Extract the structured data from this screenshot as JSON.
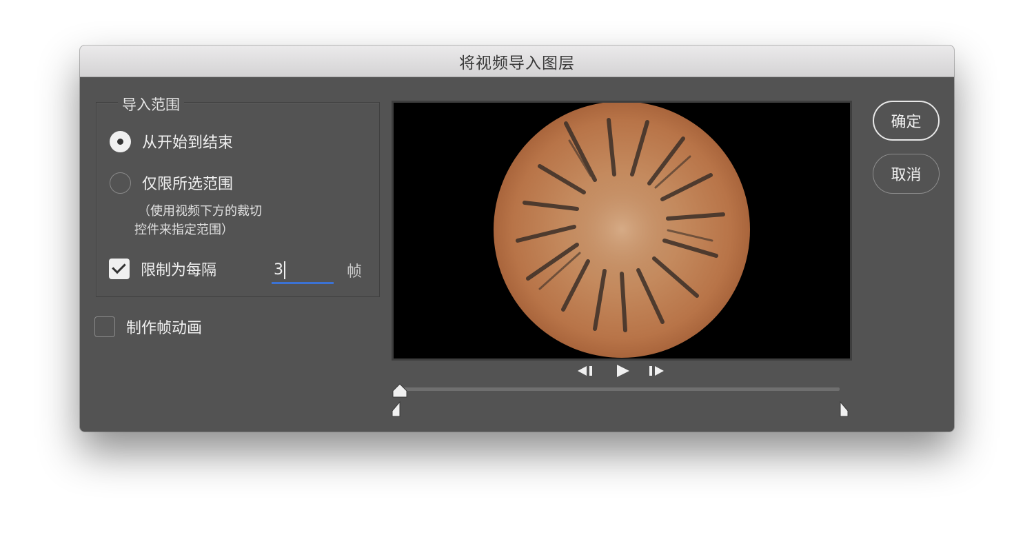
{
  "dialog": {
    "title": "将视频导入图层",
    "range_group": {
      "title": "导入范围",
      "options": [
        {
          "label": "从开始到结束",
          "selected": true
        },
        {
          "label": "仅限所选范围",
          "selected": false
        }
      ],
      "note_line1": "（使用视频下方的裁切",
      "note_line2": "控件来指定范围）",
      "limit": {
        "label": "限制为每隔",
        "checked": true,
        "value": "3",
        "unit": "帧"
      }
    },
    "make_animation": {
      "label": "制作帧动画",
      "checked": false
    },
    "buttons": {
      "ok": "确定",
      "cancel": "取消"
    },
    "playback": {
      "prev_icon": "step-back-icon",
      "play_icon": "play-icon",
      "next_icon": "step-forward-icon"
    },
    "colors": {
      "panel": "#535353",
      "accent": "#3b72d4"
    }
  }
}
